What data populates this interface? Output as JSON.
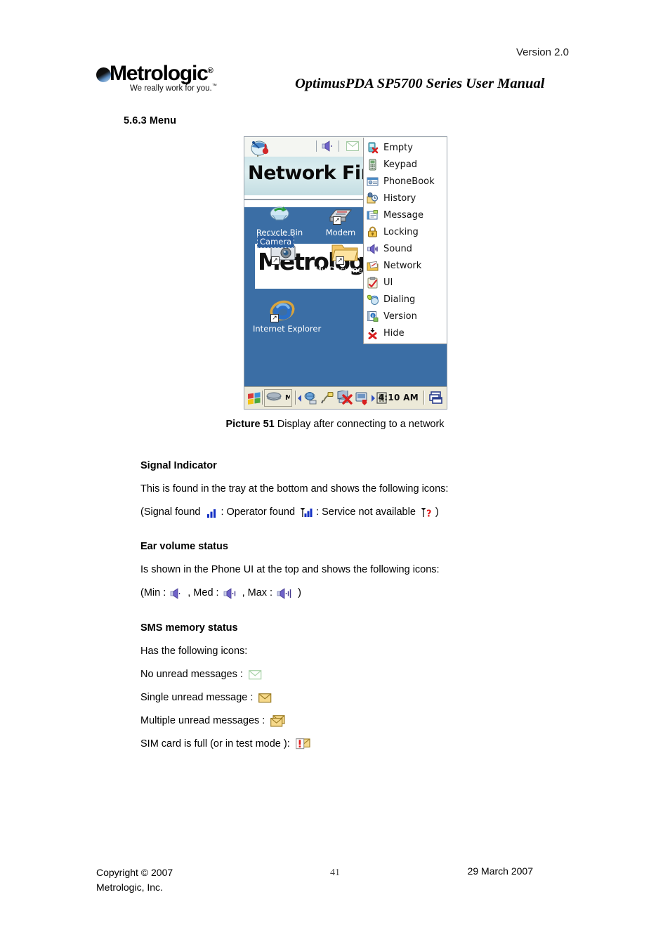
{
  "header": {
    "version": "Version 2.0",
    "logo_word": "Metrologic",
    "logo_tagline": "We really work for you.",
    "manual_title": "OptimusPDA SP5700 Series User Manual"
  },
  "section": {
    "heading": "5.6.3 Menu"
  },
  "figure": {
    "caption_bold": "Picture 51",
    "caption_text": " Display after connecting to a network"
  },
  "pda": {
    "phone_ui": {
      "title": "Network Find",
      "globe_icon": "globe-satellite-icon",
      "speaker_icon": "speaker-volume-icon",
      "envelope_icon": "envelope-empty-icon"
    },
    "desktop_icons": [
      {
        "label": "Recycle Bin",
        "icon": "recycle-bin-icon"
      },
      {
        "label": "Modem",
        "icon": "modem-icon"
      },
      {
        "label": "Camera",
        "icon": "camera-icon",
        "selected": "true"
      },
      {
        "label": "My Documents",
        "icon": "folder-icon"
      },
      {
        "label": "Internet Explorer",
        "icon": "internet-explorer-icon"
      }
    ],
    "wallpaper_text": "Metrologic",
    "menu_items": [
      {
        "label": "Empty",
        "icon": "phone-empty-icon"
      },
      {
        "label": "Keypad",
        "icon": "keypad-icon"
      },
      {
        "label": "PhoneBook",
        "icon": "phonebook-icon"
      },
      {
        "label": "History",
        "icon": "history-icon"
      },
      {
        "label": "Message",
        "icon": "message-icon"
      },
      {
        "label": "Locking",
        "icon": "padlock-icon"
      },
      {
        "label": "Sound",
        "icon": "sound-speaker-icon"
      },
      {
        "label": "Network",
        "icon": "network-icon"
      },
      {
        "label": "UI",
        "icon": "ui-clipboard-icon"
      },
      {
        "label": "Dialing",
        "icon": "dialing-icon"
      },
      {
        "label": "Version",
        "icon": "version-info-icon"
      },
      {
        "label": "Hide",
        "icon": "hide-icon"
      }
    ],
    "taskbar": {
      "start_icon": "windows-start-icon",
      "sip_icon": "input-panel-icon",
      "tray_icons": [
        "network-connection-icon",
        "plug-icon",
        "disconnect-icon",
        "eject-icon",
        "battery-icon"
      ],
      "clock": "4:10 AM",
      "desktop_icon": "show-desktop-icon"
    }
  },
  "sections": {
    "signal": {
      "heading": "Signal Indicator",
      "line1": "This is found in the tray at the bottom and shows the following icons:",
      "legend_open": "(Signal found",
      "legend_1": ": Operator found",
      "legend_2": ": Service not available",
      "legend_close": ")",
      "icons": [
        "signal-bars-icon",
        "signal-bars-antenna-icon",
        "no-service-icon"
      ]
    },
    "ear_volume": {
      "heading": "Ear volume status",
      "line1": "Is shown in the Phone UI at the top and shows the following icons:",
      "min_label": "(Min :",
      "med_label": ", Med :",
      "max_label": ", Max :",
      "close": ")",
      "icons": [
        "volume-min-icon",
        "volume-med-icon",
        "volume-max-icon"
      ]
    },
    "sms": {
      "heading": "SMS memory status",
      "line1": "Has the following icons:",
      "rows": [
        {
          "label": "No unread messages :",
          "icon": "envelope-outline-icon"
        },
        {
          "label": "Single unread message :",
          "icon": "envelope-single-icon"
        },
        {
          "label": "Multiple unread messages :",
          "icon": "envelope-multiple-icon"
        },
        {
          "label": "SIM card is full (or in test mode ):",
          "icon": "envelope-alert-icon"
        }
      ]
    }
  },
  "footer": {
    "copyright_line1": "Copyright © 2007",
    "copyright_line2": "Metrologic, Inc.",
    "page_number": "41",
    "date": "29 March 2007"
  },
  "colors": {
    "desktop_blue": "#3b6ea5",
    "taskbar": "#ece9d8",
    "phone_band": "#cfe6ea",
    "accent_red": "#d81f1f"
  }
}
